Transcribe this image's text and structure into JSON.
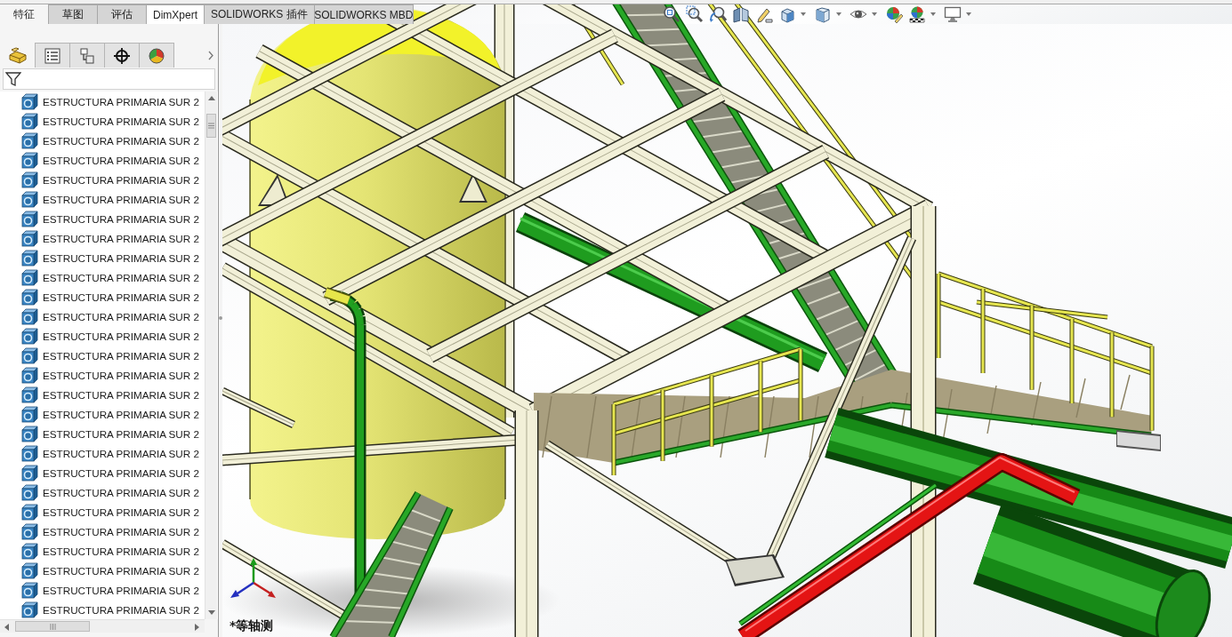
{
  "command_tabs": [
    {
      "label": "特征",
      "selected": true,
      "highlighted": false
    },
    {
      "label": "草图",
      "selected": false,
      "highlighted": false
    },
    {
      "label": "评估",
      "selected": false,
      "highlighted": false
    },
    {
      "label": "DimXpert",
      "selected": false,
      "highlighted": true
    },
    {
      "label": "SOLIDWORKS 插件",
      "selected": false,
      "highlighted": false
    },
    {
      "label": "SOLIDWORKS MBD",
      "selected": false,
      "highlighted": false
    }
  ],
  "panel": {
    "tabs": [
      {
        "kind": "feature",
        "selected": true
      },
      {
        "kind": "property",
        "selected": false
      },
      {
        "kind": "configuration",
        "selected": false
      },
      {
        "kind": "dimxpert",
        "selected": false
      },
      {
        "kind": "display",
        "selected": false
      }
    ],
    "tree": {
      "items": [
        {
          "label": "ESTRUCTURA PRIMARIA SUR 2"
        },
        {
          "label": "ESTRUCTURA PRIMARIA SUR 2"
        },
        {
          "label": "ESTRUCTURA PRIMARIA SUR 2"
        },
        {
          "label": "ESTRUCTURA PRIMARIA SUR 2"
        },
        {
          "label": "ESTRUCTURA PRIMARIA SUR 2"
        },
        {
          "label": "ESTRUCTURA PRIMARIA SUR 2"
        },
        {
          "label": "ESTRUCTURA PRIMARIA SUR 2"
        },
        {
          "label": "ESTRUCTURA PRIMARIA SUR 2"
        },
        {
          "label": "ESTRUCTURA PRIMARIA SUR 2"
        },
        {
          "label": "ESTRUCTURA PRIMARIA SUR 2"
        },
        {
          "label": "ESTRUCTURA PRIMARIA SUR 2"
        },
        {
          "label": "ESTRUCTURA PRIMARIA SUR 2"
        },
        {
          "label": "ESTRUCTURA PRIMARIA SUR 2"
        },
        {
          "label": "ESTRUCTURA PRIMARIA SUR 2"
        },
        {
          "label": "ESTRUCTURA PRIMARIA SUR 2"
        },
        {
          "label": "ESTRUCTURA PRIMARIA SUR 2"
        },
        {
          "label": "ESTRUCTURA PRIMARIA SUR 2"
        },
        {
          "label": "ESTRUCTURA PRIMARIA SUR 2"
        },
        {
          "label": "ESTRUCTURA PRIMARIA SUR 2"
        },
        {
          "label": "ESTRUCTURA PRIMARIA SUR 2"
        },
        {
          "label": "ESTRUCTURA PRIMARIA SUR 2"
        },
        {
          "label": "ESTRUCTURA PRIMARIA SUR 2"
        },
        {
          "label": "ESTRUCTURA PRIMARIA SUR 2"
        },
        {
          "label": "ESTRUCTURA PRIMARIA SUR 2"
        },
        {
          "label": "ESTRUCTURA PRIMARIA SUR 2"
        },
        {
          "label": "ESTRUCTURA PRIMARIA SUR 2"
        },
        {
          "label": "ESTRUCTURA PRIMARIA SUR 2"
        }
      ]
    }
  },
  "graphics": {
    "view_label": "*等轴测"
  }
}
